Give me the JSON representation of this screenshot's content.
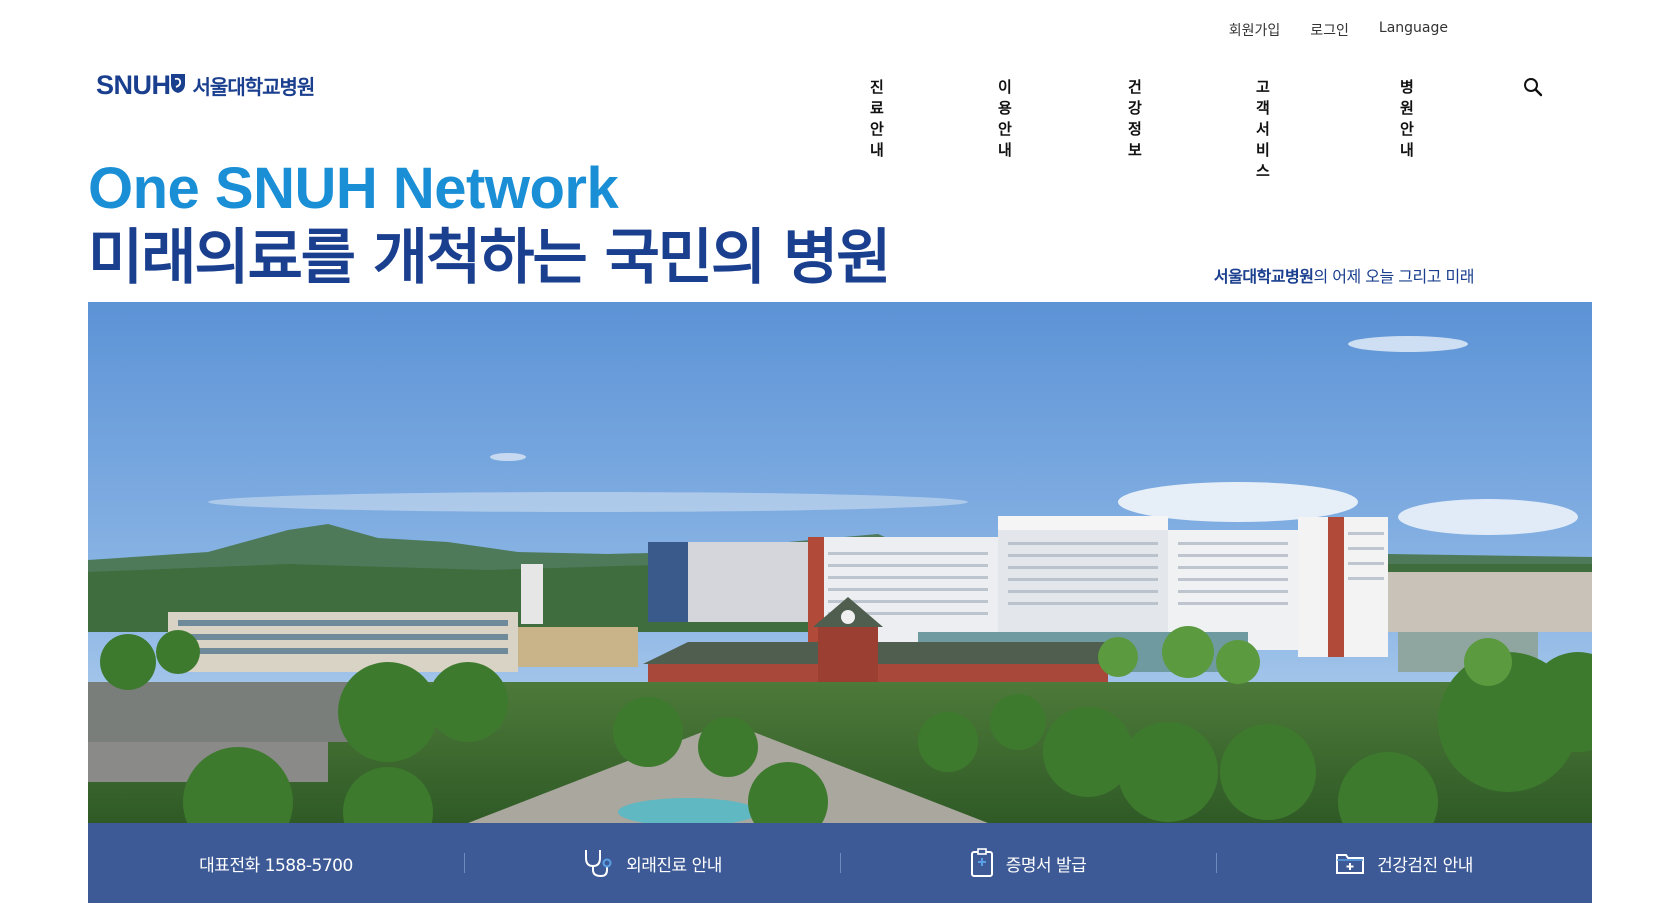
{
  "utility_nav": [
    "회원가입",
    "로그인",
    "Language"
  ],
  "logo": {
    "en": "SNUH",
    "ko": "서울대학교병원"
  },
  "main_nav": [
    "진료안내",
    "이용안내",
    "건강정보",
    "고객서비스",
    "병원안내"
  ],
  "hero": {
    "title_en": "One SNUH Network",
    "title_ko": "미래의료를 개척하는 국민의 병원",
    "subtitle_bold": "서울대학교병원",
    "subtitle_rest": "의 어제 오늘 그리고 미래"
  },
  "quick_links": {
    "phone": "대표전화 1588-5700",
    "outpatient": "외래진료 안내",
    "certificate": "증명서 발급",
    "checkup": "건강검진 안내"
  },
  "colors": {
    "brand_navy": "#1a3f8f",
    "brand_blue": "#1a8fd6",
    "quick_bar": "#3d5a96"
  },
  "icons": [
    "search-icon",
    "stethoscope-icon",
    "clipboard-icon",
    "medical-folder-icon"
  ]
}
